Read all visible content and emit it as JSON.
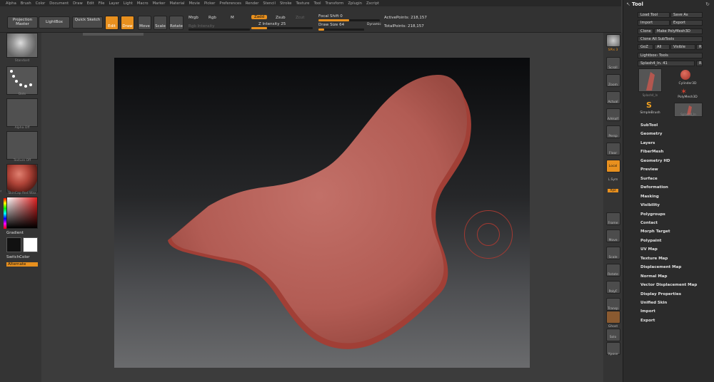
{
  "menubar": [
    "Alpha",
    "Brush",
    "Color",
    "Document",
    "Draw",
    "Edit",
    "File",
    "Layer",
    "Light",
    "Macro",
    "Marker",
    "Material",
    "Movie",
    "Picker",
    "Preferences",
    "Render",
    "Stencil",
    "Stroke",
    "Texture",
    "Tool",
    "Transform",
    "Zplugin",
    "Zscript"
  ],
  "toolbar": {
    "projection_master": "Projection Master",
    "lightbox": "LightBox",
    "quick_sketch": "Quick Sketch",
    "edit": "Edit",
    "draw": "Draw",
    "move": "Move",
    "scale": "Scale",
    "rotate": "Rotate",
    "mrgb": "Mrgb",
    "rgb": "Rgb",
    "m": "M",
    "zadd": "Zadd",
    "zsub": "Zsub",
    "zcut": "Zcut",
    "rgb_intensity": "Rgb Intensity",
    "z_intensity": "Z Intensity 25",
    "z_intensity_value": 0.25,
    "focal_shift": "Focal Shift 0",
    "focal_shift_value": 0.5,
    "draw_size": "Draw Size 64",
    "draw_size_value": 0.12,
    "dynamic": "Dynamic",
    "active_points": "ActivePoints: 218,157",
    "total_points": "TotalPoints: 218,157"
  },
  "leftshelf": {
    "brush_label": "Standard",
    "stroke_label": "Dots",
    "alpha_label": "Alpha Off",
    "texture_label": "Texture Off",
    "material_label": "SkinCap Red Wax",
    "gradient_label": "Gradient",
    "switchcolor_label": "SwitchColor",
    "alternate_label": "Alternate"
  },
  "rightshelf": {
    "spix": "SPix 3",
    "labels": [
      "BPR",
      "Scroll",
      "Zoom",
      "Actual",
      "AAHalf",
      "Persp",
      "Floor",
      "Local",
      "L.Sym",
      "Xyz",
      "",
      "Frame",
      "Move",
      "Scale",
      "Rotate",
      "PolyF",
      "Transp",
      "Ghost",
      "Solo",
      "Xpose"
    ]
  },
  "palette": {
    "title": "Tool",
    "load_tool": "Load Tool",
    "save_as": "Save As",
    "import": "Import",
    "export": "Export",
    "clone": "Clone",
    "make_polymesh": "Make PolyMesh3D",
    "clone_all": "Clone All SubTools",
    "goz": "GoZ",
    "all": "All",
    "visible": "Visible",
    "r": "R",
    "lightbox_tools": "Lightbox› Tools",
    "current_tool": "Splash4_In. 41",
    "r2": "R",
    "tiles": [
      "Splash4_In",
      "Cylinder3D",
      "PolyMesh3D",
      "SimpleBrush",
      "Splash4_In"
    ],
    "menu": [
      "SubTool",
      "Geometry",
      "Layers",
      "FiberMesh",
      "Geometry HD",
      "Preview",
      "Surface",
      "Deformation",
      "Masking",
      "Visibility",
      "Polygroups",
      "Contact",
      "Morph Target",
      "Polypaint",
      "UV Map",
      "Texture Map",
      "Displacement Map",
      "Normal Map",
      "Vector Displacement Map",
      "Display Properties",
      "Unified Skin",
      "Import",
      "Export"
    ]
  },
  "colors": {
    "accent": "#e8901e",
    "clay": "#b4574f"
  }
}
